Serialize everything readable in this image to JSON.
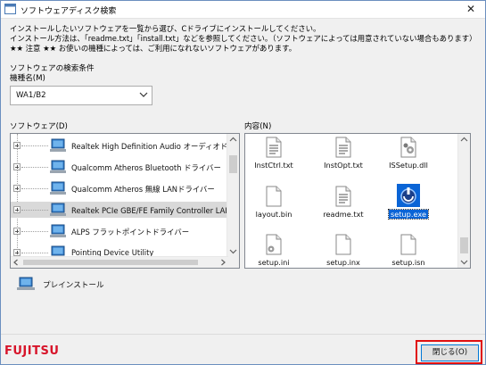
{
  "window": {
    "title": "ソフトウェアディスク検索",
    "close_glyph": "✕"
  },
  "notice": {
    "line1": "インストールしたいソフトウェアを一覧から選び、Cドライブにインストールしてください。",
    "line2": "インストール方法は、「readme.txt」「install.txt」などを参照してください。（ソフトウェアによっては用意されていない場合もあります）",
    "line3": "★★ 注意 ★★ お使いの機種によっては、ご利用になれないソフトウェアがあります。"
  },
  "search_conditions": {
    "heading": "ソフトウェアの検索条件",
    "model_label": "機種名(M)",
    "model_value": "WA1/B2"
  },
  "software": {
    "label": "ソフトウェア(D)",
    "items": [
      {
        "label": "Realtek High Definition Audio オーディオドライバ",
        "icon": "computer-icon",
        "selected": false
      },
      {
        "label": "Qualcomm Atheros Bluetooth ドライバー",
        "icon": "computer-icon",
        "selected": false
      },
      {
        "label": "Qualcomm Atheros 無線 LANドライバー",
        "icon": "computer-icon",
        "selected": false
      },
      {
        "label": "Realtek PCIe GBE/FE Family Controller LANドラ",
        "icon": "computer-icon",
        "selected": true
      },
      {
        "label": "ALPS フラットポイントドライバー",
        "icon": "computer-icon",
        "selected": false
      },
      {
        "label": "Pointing Device Utility",
        "icon": "computer-icon",
        "selected": false
      }
    ]
  },
  "contents": {
    "label": "内容(N)",
    "files": [
      {
        "name": "InstCtrl.txt",
        "icon": "text-file-icon",
        "selected": false
      },
      {
        "name": "InstOpt.txt",
        "icon": "text-file-icon",
        "selected": false
      },
      {
        "name": "ISSetup.dll",
        "icon": "dll-file-icon",
        "selected": false
      },
      {
        "name": "layout.bin",
        "icon": "blank-file-icon",
        "selected": false
      },
      {
        "name": "readme.txt",
        "icon": "text-file-icon",
        "selected": false
      },
      {
        "name": "setup.exe",
        "icon": "setup-exe-icon",
        "selected": true
      },
      {
        "name": "setup.ini",
        "icon": "ini-file-icon",
        "selected": false
      },
      {
        "name": "setup.inx",
        "icon": "blank-file-icon",
        "selected": false
      },
      {
        "name": "setup.isn",
        "icon": "blank-file-icon",
        "selected": false
      }
    ]
  },
  "preinstall": {
    "label": "プレインストール",
    "icon": "computer-icon"
  },
  "footer": {
    "logo": "FUJITSU",
    "close_button": "閉じる(O)"
  },
  "colors": {
    "brand": "#d7142a",
    "selection": "#0a64d6",
    "highlight": "#e01010"
  }
}
